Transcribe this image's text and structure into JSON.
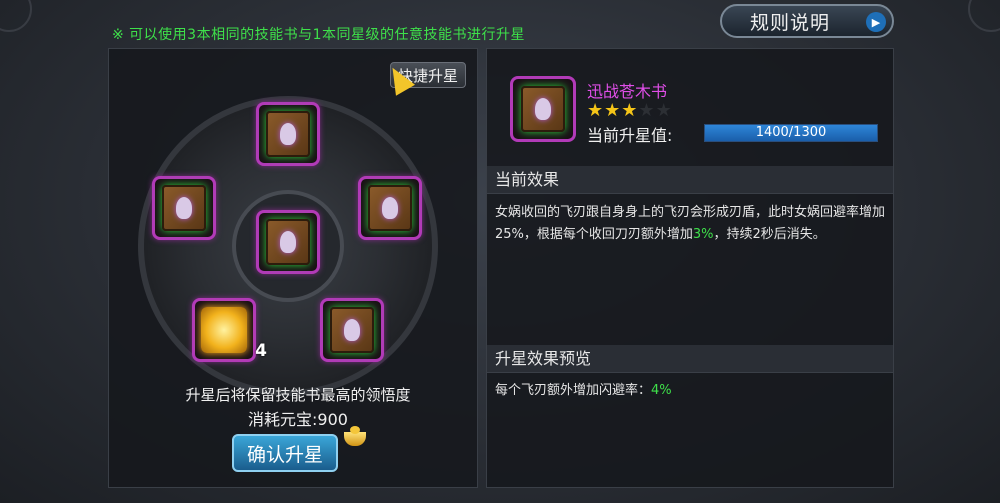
{
  "tip": "※ 可以使用3本相同的技能书与1本同星级的任意技能书进行升星",
  "rules_button": "规则说明",
  "quick_star_button": "快捷升星",
  "slots": {
    "material_count": "4"
  },
  "keep_note": "升星后将保留技能书最高的领悟度",
  "cost_label": "消耗元宝:900",
  "confirm_button": "确认升星",
  "skill": {
    "name": "迅战苍木书",
    "stars_filled": 3,
    "stars_total": 5,
    "progress_label": "当前升星值:",
    "progress_text": "1400/1300",
    "progress_fraction": 1.0
  },
  "current_effect": {
    "title": "当前效果",
    "text_a": "女娲收回的飞刃跟自身身上的飞刃会形成刃盾，此时女娲回避率增加25%，根据每个收回刀刃额外增加",
    "highlight": "3%",
    "text_b": "，持续2秒后消失。"
  },
  "preview_effect": {
    "title": "升星效果预览",
    "text_a": "每个飞刃额外增加闪避率：",
    "highlight": "4%"
  },
  "colors": {
    "tip_green": "#3ee04a",
    "skill_name_purple": "#e04ee8",
    "star_gold": "#f5c518",
    "progress_blue": "#2e86d8"
  }
}
